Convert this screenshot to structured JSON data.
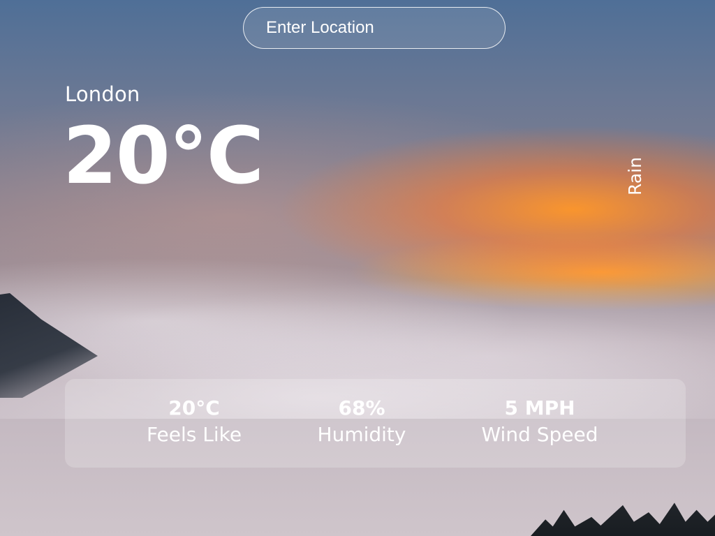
{
  "search": {
    "placeholder": "Enter Location"
  },
  "weather": {
    "city": "London",
    "temperature": "20°C",
    "condition": "Rain"
  },
  "stats": {
    "feels_like": {
      "value": "20°C",
      "label": "Feels Like"
    },
    "humidity": {
      "value": "68%",
      "label": "Humidity"
    },
    "wind_speed": {
      "value": "5 MPH",
      "label": "Wind Speed"
    }
  },
  "colors": {
    "text": "#ffffff",
    "panel": "rgba(255,255,255,0.20)"
  }
}
